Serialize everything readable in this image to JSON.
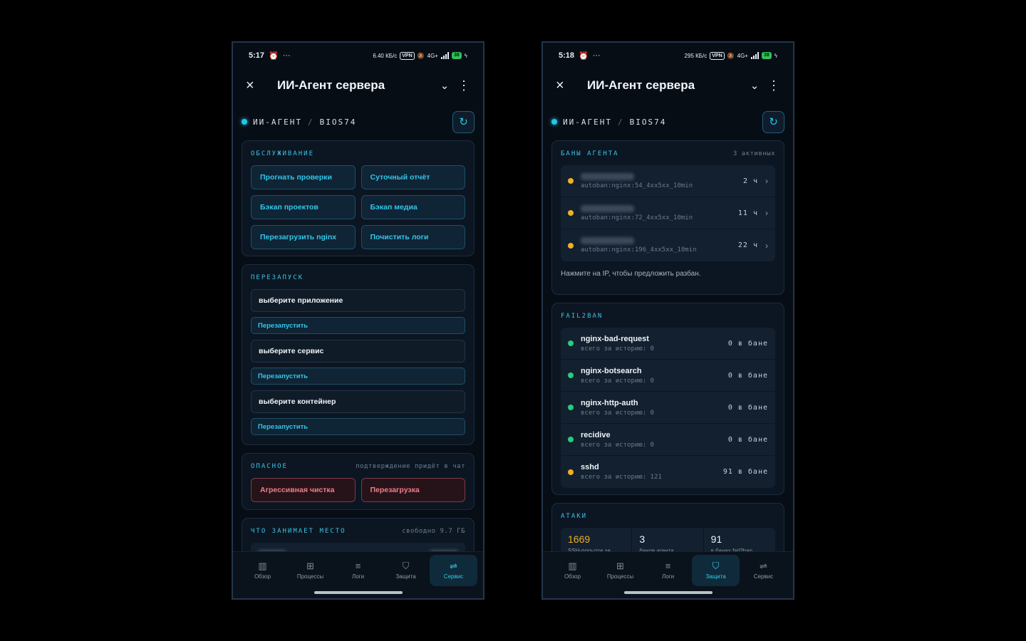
{
  "app": {
    "title": "ИИ-Агент сервера",
    "close_icon": "×",
    "dropdown_icon": "⌄",
    "menu_icon": "⋮",
    "refresh_icon": "↻"
  },
  "breadcrumb": {
    "agent": "ИИ-АГЕНТ",
    "separator": "/",
    "server": "BIOS74"
  },
  "left": {
    "status": {
      "time": "5:17",
      "speed": "6.40 КБ/с",
      "vpn": "VPN",
      "network": "4G+",
      "battery": "38"
    },
    "maintenance": {
      "title": "ОБСЛУЖИВАНИЕ",
      "buttons": [
        "Прогнать проверки",
        "Суточный отчёт",
        "Бэкап проектов",
        "Бэкап медиа",
        "Перезагрузить nginx",
        "Почистить логи"
      ]
    },
    "restart": {
      "title": "ПЕРЕЗАПУСК",
      "select_app": "выберите приложение",
      "select_service": "выберите сервис",
      "select_container": "выберите контейнер",
      "restart_label": "Перезапустить"
    },
    "danger": {
      "title": "ОПАСНОЕ",
      "note": "подтверждение придёт в чат",
      "buttons": [
        "Агрессивная чистка",
        "Перезагрузка"
      ]
    },
    "space": {
      "title": "ЧТО ЗАНИМАЕТ МЕСТО",
      "note": "свободно 9.7 ГБ"
    },
    "nav_active": "Сервис"
  },
  "right": {
    "status": {
      "time": "5:18",
      "speed": "295 КБ/с",
      "vpn": "VPN",
      "network": "4G+",
      "battery": "38"
    },
    "bans": {
      "title": "БАНЫ АГЕНТА",
      "note": "3 активных",
      "items": [
        {
          "reason": "autoban:nginx:54_4xx5xx_10min",
          "time": "2 ч"
        },
        {
          "reason": "autoban:nginx:72_4xx5xx_10min",
          "time": "11 ч"
        },
        {
          "reason": "autoban:nginx:196_4xx5xx_10min",
          "time": "22 ч"
        }
      ],
      "hint": "Нажмите на IP, чтобы предложить разбан."
    },
    "fail2ban": {
      "title": "FAIL2BAN",
      "items": [
        {
          "name": "nginx-bad-request",
          "history": "всего за историю: 0",
          "count": "0 в бане",
          "status": "green"
        },
        {
          "name": "nginx-botsearch",
          "history": "всего за историю: 0",
          "count": "0 в бане",
          "status": "green"
        },
        {
          "name": "nginx-http-auth",
          "history": "всего за историю: 0",
          "count": "0 в бане",
          "status": "green"
        },
        {
          "name": "recidive",
          "history": "всего за историю: 0",
          "count": "0 в бане",
          "status": "green"
        },
        {
          "name": "sshd",
          "history": "всего за историю: 121",
          "count": "91 в бане",
          "status": "yellow"
        }
      ]
    },
    "attacks": {
      "title": "АТАКИ",
      "stats": [
        {
          "value": "1669",
          "label": "SSH-попыток за"
        },
        {
          "value": "3",
          "label": "банов агента"
        },
        {
          "value": "91",
          "label": "в банах fail2ban"
        }
      ]
    },
    "nav_active": "Защита"
  },
  "nav": {
    "items": [
      {
        "label": "Обзор",
        "icon": "chart-icon",
        "glyph": "▥"
      },
      {
        "label": "Процессы",
        "icon": "chip-icon",
        "glyph": "⊞"
      },
      {
        "label": "Логи",
        "icon": "lines-icon",
        "glyph": "≡"
      },
      {
        "label": "Защита",
        "icon": "shield-icon",
        "glyph": "⛉"
      },
      {
        "label": "Сервис",
        "icon": "sliders-icon",
        "glyph": "⇌"
      }
    ]
  },
  "colors": {
    "accent": "#35c9ec",
    "danger": "#f07e89",
    "ok": "#21d07a",
    "warn": "#f0b021",
    "bg": "#070d15"
  }
}
